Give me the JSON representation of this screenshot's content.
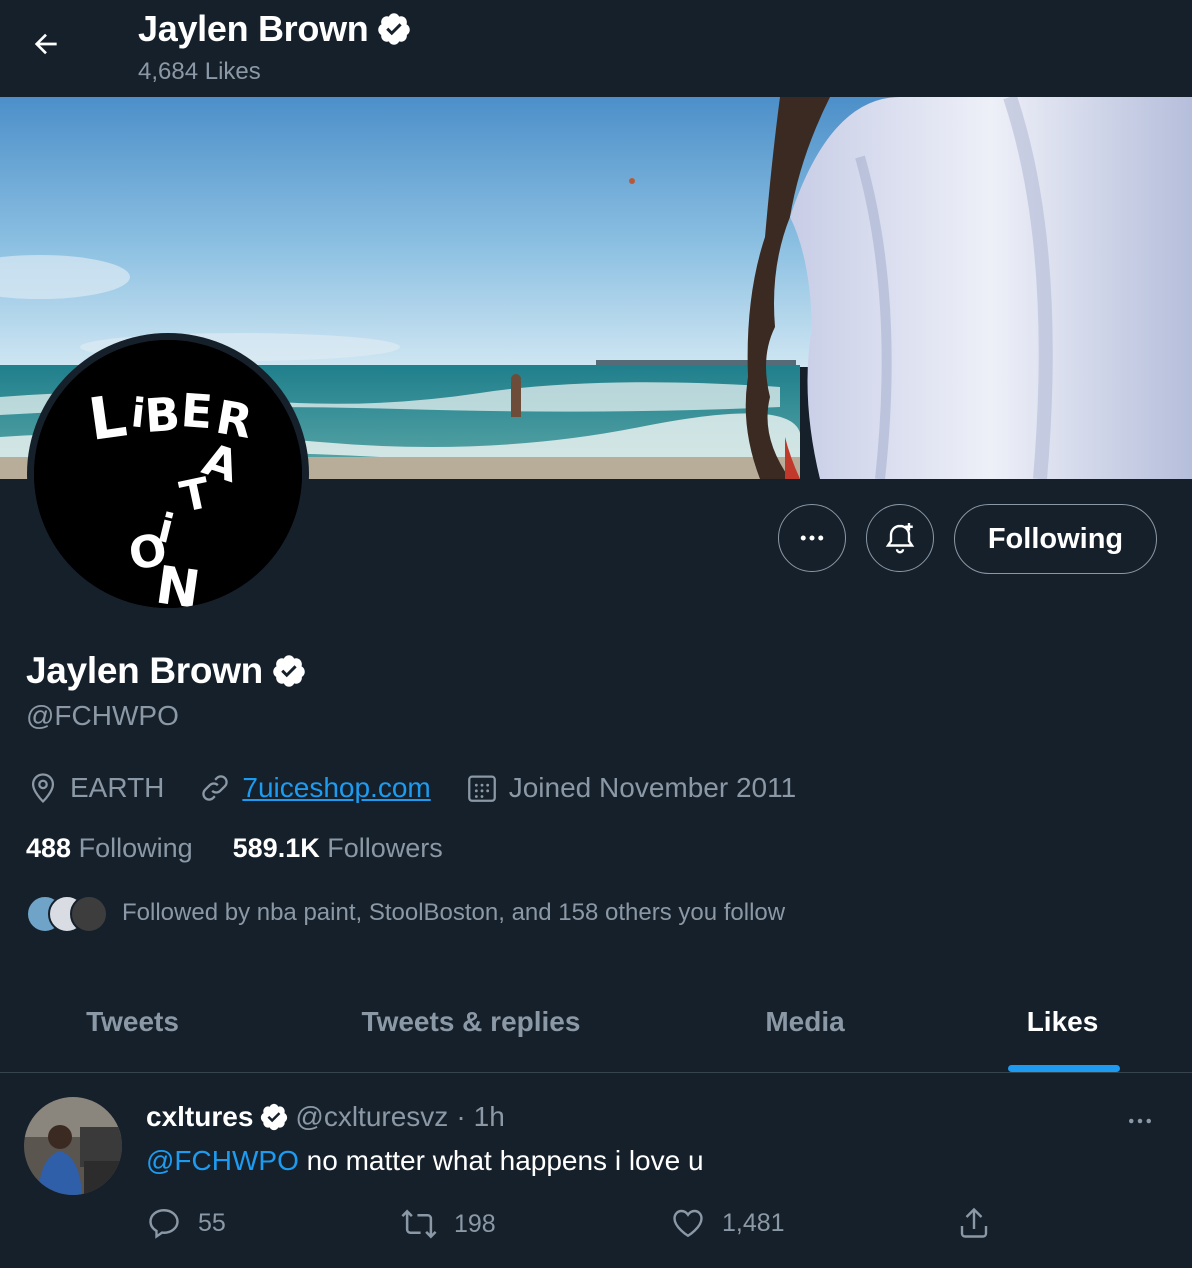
{
  "header": {
    "name": "Jaylen Brown",
    "likes_count": "4,684 Likes"
  },
  "actions": {
    "follow_label": "Following"
  },
  "profile": {
    "name": "Jaylen Brown",
    "handle": "@FCHWPO",
    "location": "EARTH",
    "website": "7uiceshop.com",
    "joined": "Joined November 2011",
    "following_count": "488",
    "following_label": "Following",
    "followers_count": "589.1K",
    "followers_label": "Followers",
    "followed_by": "Followed by nba paint, StoolBoston, and 158 others you follow"
  },
  "tabs": [
    {
      "label": "Tweets"
    },
    {
      "label": "Tweets & replies"
    },
    {
      "label": "Media"
    },
    {
      "label": "Likes"
    }
  ],
  "tweet": {
    "author": "cxltures",
    "handle": "@cxlturesvz",
    "dot": "·",
    "time": "1h",
    "mention": "@FCHWPO",
    "text": " no matter what happens i love u",
    "replies": "55",
    "retweets": "198",
    "likes": "1,481"
  },
  "colors": {
    "background": "#15202b",
    "accent": "#1d9bf0",
    "secondary_text": "#8b98a5"
  },
  "icons": [
    "back-arrow-icon",
    "verified-badge-icon",
    "more-icon",
    "bell-plus-icon",
    "location-icon",
    "link-icon",
    "calendar-icon",
    "reply-icon",
    "retweet-icon",
    "heart-icon",
    "share-icon"
  ]
}
